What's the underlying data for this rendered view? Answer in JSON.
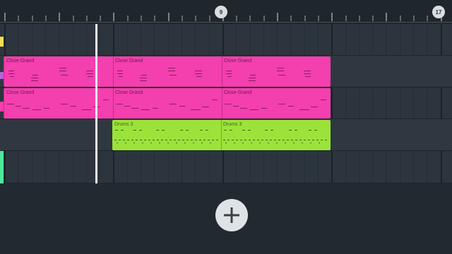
{
  "ruler": {
    "markers": [
      "9",
      "17"
    ]
  },
  "tracks": [
    {
      "color": "#f2df4a",
      "clips": []
    },
    {
      "color": "#b864d8",
      "clips": [
        {
          "label": "Close Grand",
          "color": "pink"
        },
        {
          "label": "Close Grand",
          "color": "pink"
        },
        {
          "label": "Close Grand",
          "color": "pink"
        }
      ]
    },
    {
      "color": "#f43fae",
      "clips": [
        {
          "label": "Close Grand",
          "color": "pink"
        },
        {
          "label": "Close Grand",
          "color": "pink"
        },
        {
          "label": "Close Grand",
          "color": "pink"
        }
      ]
    },
    {
      "color": "#9be33a",
      "clips": [
        {
          "label": "Drums 3",
          "color": "green"
        },
        {
          "label": "Drums 3",
          "color": "green"
        }
      ]
    },
    {
      "color": "#4fe89c",
      "clips": []
    }
  ],
  "add_button": {
    "icon": "plus-icon"
  }
}
